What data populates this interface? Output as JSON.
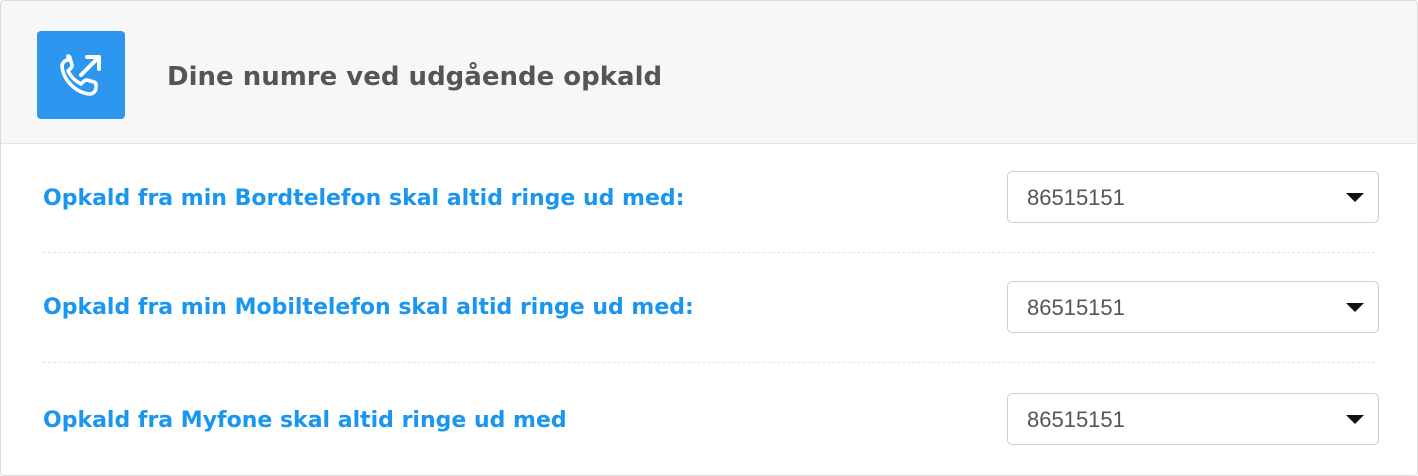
{
  "header": {
    "icon": "phone-outgoing-icon",
    "title": "Dine numre ved udgående opkald"
  },
  "rows": [
    {
      "label": "Opkald fra min Bordtelefon skal altid ringe ud med:",
      "selected": "86515151"
    },
    {
      "label": "Opkald fra min Mobiltelefon skal altid ringe ud med:",
      "selected": "86515151"
    },
    {
      "label": "Opkald fra Myfone skal altid ringe ud med",
      "selected": "86515151"
    }
  ],
  "colors": {
    "accent": "#2d96ee",
    "label": "#1a96ee",
    "title": "#555555",
    "header_bg": "#f7f7f7"
  }
}
